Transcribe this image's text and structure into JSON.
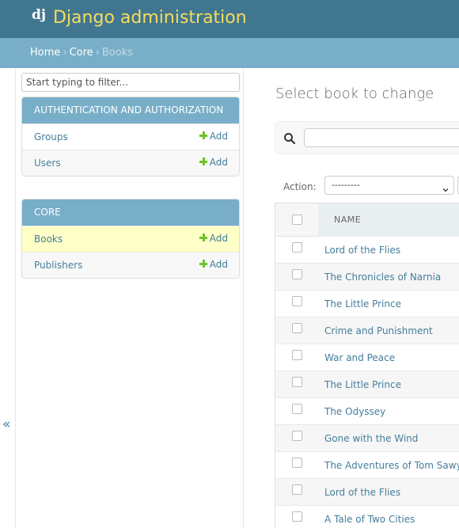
{
  "header": {
    "logo_text": "dj",
    "site_title": "Django administration"
  },
  "breadcrumbs": {
    "items": [
      "Home",
      "Core"
    ],
    "separator": "›",
    "current": "Books"
  },
  "sidebar": {
    "toggle_label": "«",
    "filter_placeholder": "Start typing to filter...",
    "modules": [
      {
        "title": "AUTHENTICATION AND AUTHORIZATION",
        "models": [
          {
            "name": "Groups",
            "add_label": "Add"
          },
          {
            "name": "Users",
            "add_label": "Add"
          }
        ]
      },
      {
        "title": "CORE",
        "models": [
          {
            "name": "Books",
            "add_label": "Add",
            "selected": true
          },
          {
            "name": "Publishers",
            "add_label": "Add"
          }
        ]
      }
    ]
  },
  "content": {
    "title": "Select book to change",
    "search": {
      "value": "",
      "placeholder": ""
    },
    "action_label": "Action:",
    "action_selected": "---------",
    "column_header": "NAME",
    "rows": [
      "Lord of the Flies",
      "The Chronicles of Narnia",
      "The Little Prince",
      "Crime and Punishment",
      "War and Peace",
      "The Little Prince",
      "The Odyssey",
      "Gone with the Wind",
      "The Adventures of Tom Sawy",
      "Lord of the Flies",
      "A Tale of Two Cities"
    ]
  },
  "colors": {
    "header_bg": "#417690",
    "branding": "#f5dd5d",
    "breadcrumb_bg": "#79aec8",
    "link": "#447e9b",
    "selected_row": "#ffffc8",
    "add_icon": "#70bf2b"
  }
}
